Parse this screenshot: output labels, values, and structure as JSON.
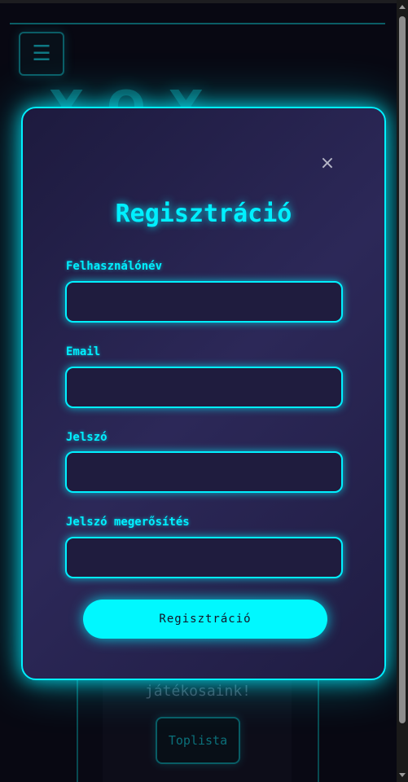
{
  "background": {
    "menu_icon": "☰",
    "title": "XOX",
    "card_text": "játékosaink!",
    "leaderboard_button": "Toplista"
  },
  "modal": {
    "close_icon": "×",
    "title": "Regisztráció",
    "fields": [
      {
        "label": "Felhasználónév",
        "value": "",
        "placeholder": ""
      },
      {
        "label": "Email",
        "value": "",
        "placeholder": ""
      },
      {
        "label": "Jelszó",
        "value": "",
        "placeholder": ""
      },
      {
        "label": "Jelszó megerősítés",
        "value": "",
        "placeholder": ""
      }
    ],
    "submit_label": "Regisztráció"
  },
  "colors": {
    "accent": "#00f0ff",
    "modal_bg": "#2c2858",
    "page_bg": "#0a0a14"
  }
}
